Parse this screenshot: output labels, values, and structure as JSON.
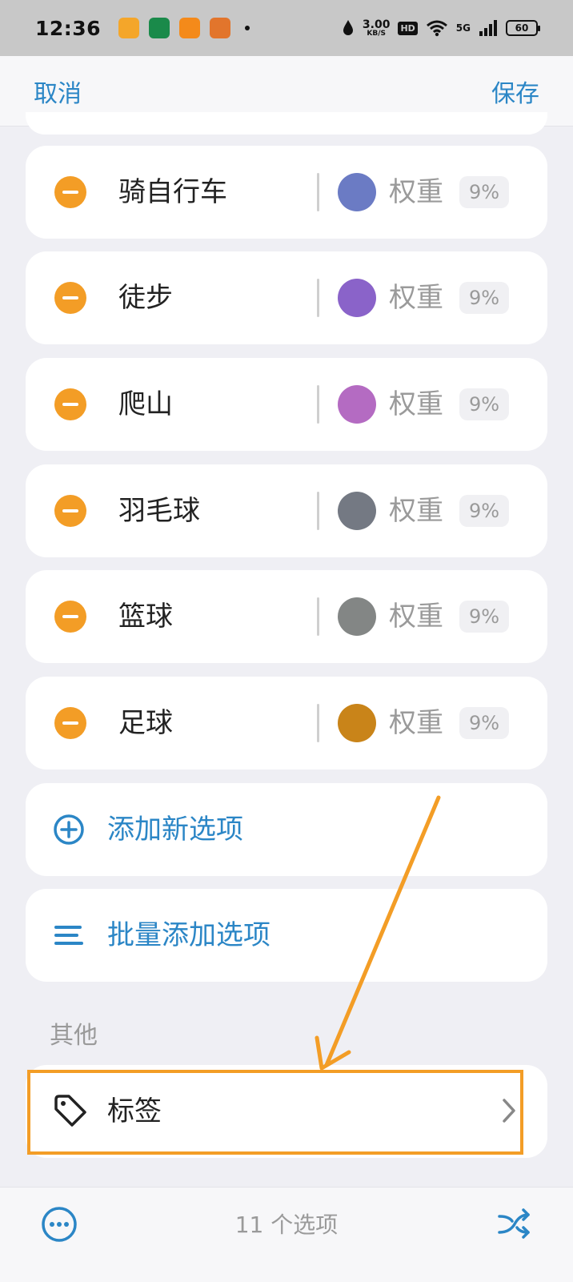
{
  "status_bar": {
    "time": "12:36",
    "net_speed_value": "3.00",
    "net_speed_unit": "KB/S",
    "hd_label": "HD",
    "signal_label": "5G",
    "battery": "60"
  },
  "top_bar": {
    "cancel_label": "取消",
    "save_label": "保存"
  },
  "weight_label": "权重",
  "items": [
    {
      "name": "骑自行车",
      "color": "#6b7bc4",
      "weight": "9%"
    },
    {
      "name": "徒步",
      "color": "#8a63c9",
      "weight": "9%"
    },
    {
      "name": "爬山",
      "color": "#b46bc2",
      "weight": "9%"
    },
    {
      "name": "羽毛球",
      "color": "#747983",
      "weight": "9%"
    },
    {
      "name": "篮球",
      "color": "#838685",
      "weight": "9%"
    },
    {
      "name": "足球",
      "color": "#c98419",
      "weight": "9%"
    }
  ],
  "actions": {
    "add_new": "添加新选项",
    "batch_add": "批量添加选项"
  },
  "section_other": "其他",
  "tags_label": "标签",
  "bottom_bar": {
    "count_text": "11 个选项"
  },
  "colors": {
    "accent": "#2b86c6",
    "remove": "#f39d26",
    "highlight": "#f39d26"
  }
}
